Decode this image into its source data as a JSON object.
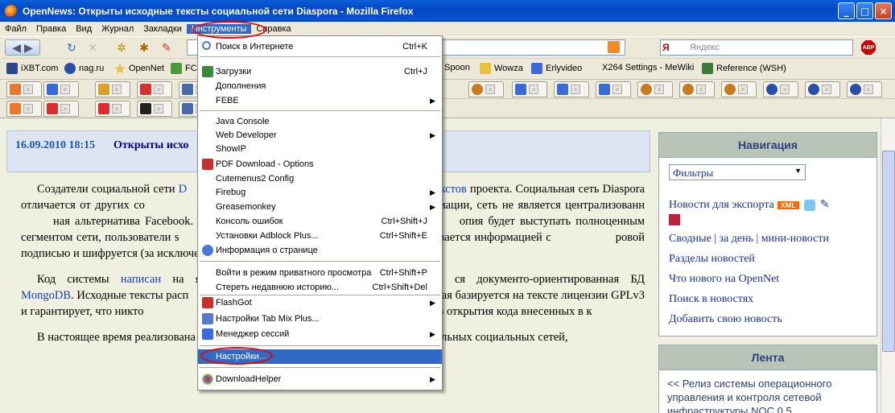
{
  "window": {
    "title": "OpenNews: Открыты исходные тексты социальной сети Diaspora - Mozilla Firefox"
  },
  "menubar": [
    "Файл",
    "Правка",
    "Вид",
    "Журнал",
    "Закладки",
    "Инструменты",
    "Справка"
  ],
  "search": {
    "placeholder": "Яндекс",
    "engine": "Я"
  },
  "abp": "ABP",
  "bookmarks": [
    "iXBT.com",
    "nag.ru",
    "OpenNet",
    "FC",
    "Spoon",
    "Wowza",
    "Erlyvideo",
    "X264 Settings - MeWiki",
    "Reference (WSH)"
  ],
  "tools_menu": {
    "items": [
      {
        "label": "Поиск в Интернете",
        "shortcut": "Ctrl+K",
        "icon": "search-icon"
      },
      {
        "label": "Загрузки",
        "shortcut": "Ctrl+J",
        "icon": "download-icon"
      },
      {
        "label": "Дополнения",
        "shortcut": ""
      },
      {
        "label": "FEBE",
        "shortcut": "",
        "submenu": true
      },
      {
        "label": "Java Console",
        "shortcut": ""
      },
      {
        "label": "Web Developer",
        "shortcut": "",
        "submenu": true
      },
      {
        "label": "ShowIP",
        "shortcut": ""
      },
      {
        "label": "PDF Download - Options",
        "shortcut": "",
        "icon": "pdf-icon"
      },
      {
        "label": "Cutemenus2 Config",
        "shortcut": ""
      },
      {
        "label": "Firebug",
        "shortcut": "",
        "submenu": true
      },
      {
        "label": "Greasemonkey",
        "shortcut": "",
        "submenu": true
      },
      {
        "label": "Консоль ошибок",
        "shortcut": "Ctrl+Shift+J"
      },
      {
        "label": "Установки Adblock Plus...",
        "shortcut": "Ctrl+Shift+E"
      },
      {
        "label": "Информация о странице",
        "shortcut": "",
        "icon": "info-icon"
      },
      {
        "label": "Войти в режим приватного просмотра",
        "shortcut": "Ctrl+Shift+P"
      },
      {
        "label": "Стереть недавнюю историю...",
        "shortcut": "Ctrl+Shift+Del"
      },
      {
        "label": "FlashGot",
        "shortcut": "",
        "submenu": true,
        "icon": "flashgot-icon"
      },
      {
        "label": "Настройки Tab Mix Plus...",
        "shortcut": "",
        "icon": "tabmix-icon"
      },
      {
        "label": "Менеджер сессий",
        "shortcut": "",
        "submenu": true,
        "icon": "session-icon"
      },
      {
        "label": "Настройки...",
        "shortcut": "",
        "highlighted": true
      },
      {
        "label": "DownloadHelper",
        "shortcut": "",
        "submenu": true,
        "icon": "downloadhelper-icon"
      }
    ]
  },
  "article": {
    "date": "16.09.2010 18:15",
    "title": "Открыты исхо",
    "p1a": "Создатели социальной сети ",
    "p1link": "D",
    "p1link2": "х текстов",
    "p1b": " проекта. Социальная сеть Diaspora отличается от других со",
    "p1c": "м сохранения частной информации, сеть не является централизованн",
    "p1d": "ная альтернатива Facebook. Каждый может установить локально своі",
    "p1e": "опия будет выступать полноценным сегментом сети, пользователи s",
    "p1f": "пользователей из других систем и обменивается информацией с",
    "p1g": "ровой подписью и шифруется (за исключением фотографий).",
    "p2a": "Код системы ",
    "p2link": "написан",
    "p2b": " на язы",
    "p2c": "ся документо-ориентированная БД ",
    "p2link2": "MongoDB",
    "p2d": ". Исходные тексты расп",
    "p2e": "орая базируется на тексте лицензии GPLv3 и гарантирует, что никто",
    "p2f": "жение для создания сетевого сервиса без открытия кода внесенных в к",
    "p3": "В настоящее время реализована базовая функциональность по созданию персональных социальных сетей,"
  },
  "sidebar": {
    "nav_title": "Навигация",
    "filter": "Фильтры",
    "export": "Новости для экспорта",
    "xml": "XML",
    "links": [
      "Сводные",
      "за день",
      "мини-новости"
    ],
    "link_sections": "Разделы новостей",
    "link_whatsnew": "Что нового на OpenNet",
    "link_search": "Поиск в новостях",
    "link_add": "Добавить свою новость",
    "lenta_title": "Лента",
    "lenta_item": "<< Релиз системы операционного управления и контроля сетевой инфраструктуры NOC 0.5"
  }
}
